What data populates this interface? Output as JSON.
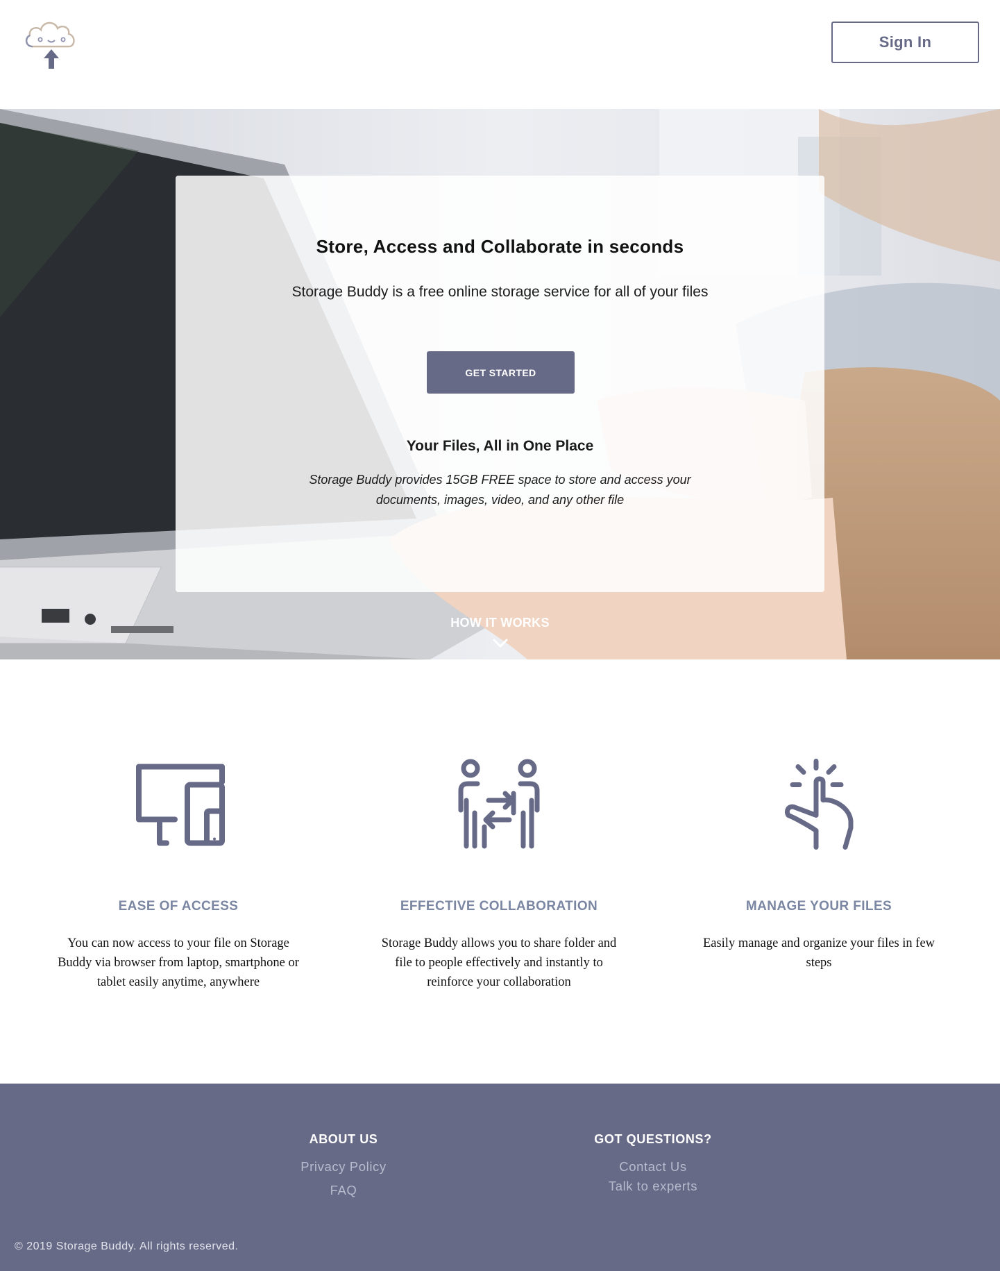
{
  "header": {
    "logo_alt": "Storage Buddy",
    "signin_label": "Sign In"
  },
  "hero": {
    "title": "Store, Access and Collaborate in seconds",
    "subtitle": "Storage Buddy is a free online storage service for all of your files",
    "cta_label": "GET STARTED",
    "files_title": "Your Files, All in One Place",
    "files_desc": "Storage Buddy provides 15GB FREE space to store and access your documents, images, video, and any other file",
    "how_it_works": "HOW IT WORKS"
  },
  "features": [
    {
      "title": "EASE OF ACCESS",
      "text": "You can now access to your file on Storage Buddy via browser from laptop, smartphone or tablet easily anytime, anywhere",
      "icon": "devices-icon"
    },
    {
      "title": "EFFECTIVE COLLABORATION",
      "text": "Storage Buddy allows you to share folder and file to people effectively and instantly to reinforce your collaboration",
      "icon": "collaboration-icon"
    },
    {
      "title": "MANAGE YOUR FILES",
      "text": "Easily manage and organize your files in few steps",
      "icon": "tap-gesture-icon"
    }
  ],
  "footer": {
    "about": {
      "title": "ABOUT US",
      "links": [
        "Privacy Policy",
        "FAQ"
      ]
    },
    "questions": {
      "title": "GOT QUESTIONS?",
      "links": [
        "Contact Us",
        "Talk to experts"
      ]
    },
    "copyright": "© 2019 Storage Buddy. All rights reserved."
  },
  "colors": {
    "brand": "#676a87",
    "feature_title": "#7a86a2",
    "footer_link": "#b8bbcd"
  }
}
